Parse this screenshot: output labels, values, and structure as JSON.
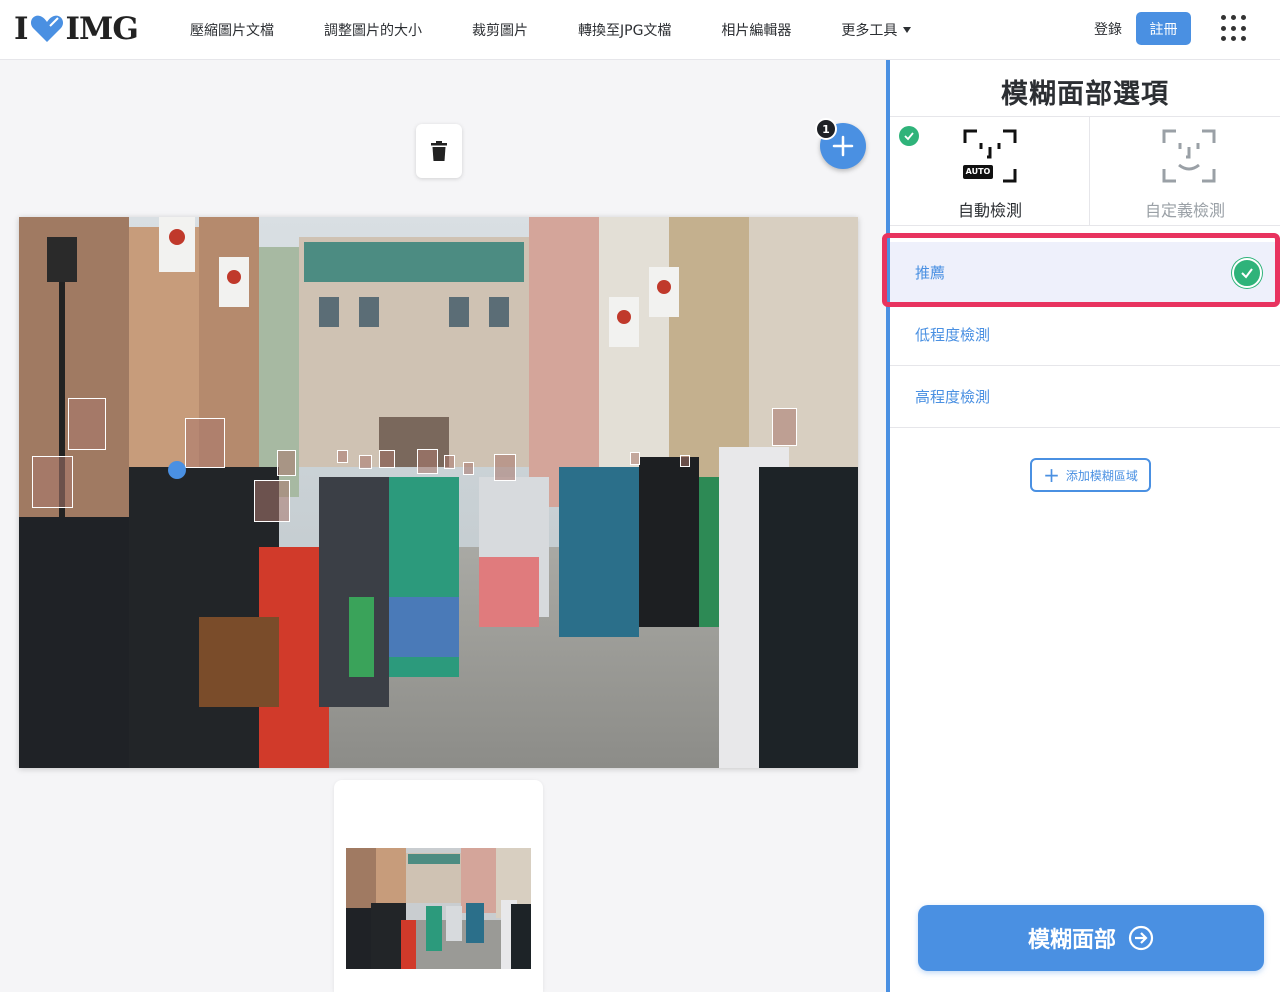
{
  "header": {
    "logo_left": "I",
    "logo_right": "IMG",
    "nav": [
      {
        "label": "壓縮圖片文檔"
      },
      {
        "label": "調整圖片的大小"
      },
      {
        "label": "裁剪圖片"
      },
      {
        "label": "轉換至JPG文檔"
      },
      {
        "label": "相片編輯器"
      },
      {
        "label": "更多工具"
      }
    ],
    "login_label": "登錄",
    "signup_label": "註冊"
  },
  "workspace": {
    "file_count_badge": "1",
    "icons": {
      "trash": "trash-icon",
      "add": "plus-icon"
    }
  },
  "sidebar": {
    "title": "模糊面部選項",
    "modes": [
      {
        "label": "自動檢測",
        "badge": "AUTO",
        "selected": true
      },
      {
        "label": "自定義檢測",
        "selected": false
      }
    ],
    "options": [
      {
        "label": "推薦",
        "selected": true
      },
      {
        "label": "低程度檢測",
        "selected": false
      },
      {
        "label": "高程度檢測",
        "selected": false
      }
    ],
    "add_area_label": "添加模糊區域",
    "blur_button_label": "模糊面部"
  },
  "colors": {
    "accent": "#4a90e2",
    "success": "#2fb37a",
    "highlight": "#e8335f"
  }
}
